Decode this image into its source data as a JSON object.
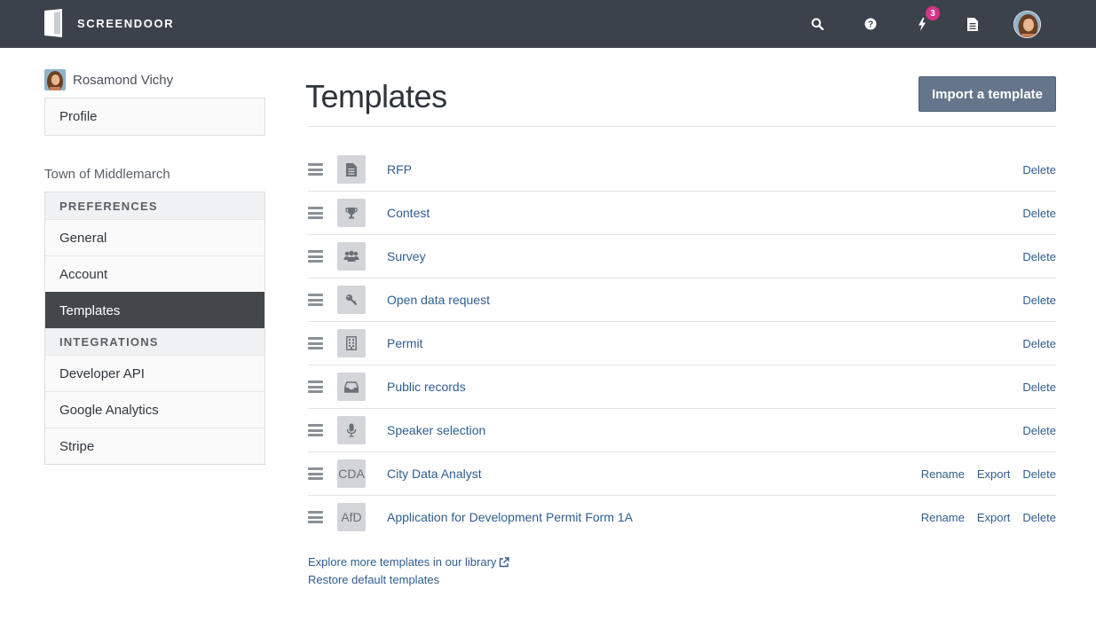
{
  "app": {
    "name": "SCREENDOOR"
  },
  "topbar": {
    "notification_count": "3"
  },
  "sidebar": {
    "user_name": "Rosamond Vichy",
    "profile_label": "Profile",
    "org_name": "Town of Middlemarch",
    "preferences_header": "PREFERENCES",
    "preferences_items": [
      "General",
      "Account",
      "Templates"
    ],
    "integrations_header": "INTEGRATIONS",
    "integrations_items": [
      "Developer API",
      "Google Analytics",
      "Stripe"
    ],
    "active_item": "Templates"
  },
  "main": {
    "title": "Templates",
    "import_label": "Import a template",
    "actions": {
      "rename": "Rename",
      "export": "Export",
      "delete": "Delete"
    },
    "templates": [
      {
        "name": "RFP",
        "icon": "document-icon",
        "custom": false
      },
      {
        "name": "Contest",
        "icon": "trophy-icon",
        "custom": false
      },
      {
        "name": "Survey",
        "icon": "users-icon",
        "custom": false
      },
      {
        "name": "Open data request",
        "icon": "key-icon",
        "custom": false
      },
      {
        "name": "Permit",
        "icon": "building-icon",
        "custom": false
      },
      {
        "name": "Public records",
        "icon": "inbox-icon",
        "custom": false
      },
      {
        "name": "Speaker selection",
        "icon": "microphone-icon",
        "custom": false
      },
      {
        "name": "City Data Analyst",
        "abbr": "CDA",
        "custom": true
      },
      {
        "name": "Application for Development Permit Form 1A",
        "abbr": "AfD",
        "custom": true
      }
    ],
    "explore_link": "Explore more templates in our library",
    "restore_link": "Restore default templates"
  }
}
